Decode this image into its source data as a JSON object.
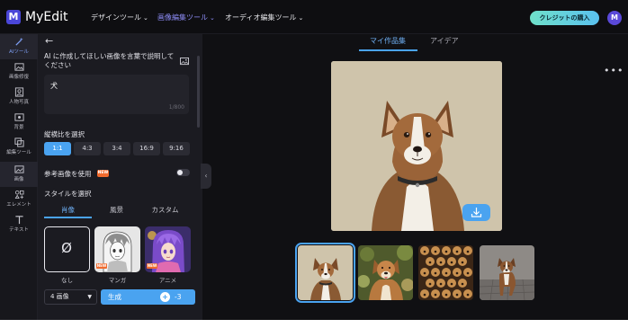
{
  "header": {
    "logo_mark": "M",
    "app_name": "MyEdit",
    "nav": [
      {
        "label": "デザインツール",
        "active": false
      },
      {
        "label": "画像編集ツール",
        "active": true
      },
      {
        "label": "オーディオ編集ツール",
        "active": false
      }
    ],
    "caret": "⌄",
    "buy_credits_label": "クレジットの購入",
    "avatar_initial": "M"
  },
  "rail": [
    {
      "label": "AIツール",
      "icon": "magic-wand-icon",
      "active": true
    },
    {
      "label": "画像修復",
      "icon": "image-repair-icon",
      "active": false
    },
    {
      "label": "人物写真",
      "icon": "portrait-icon",
      "active": false
    },
    {
      "label": "背景",
      "icon": "background-icon",
      "active": false
    },
    {
      "label": "編集ツール",
      "icon": "edit-tools-icon",
      "active": false
    },
    {
      "label": "画像",
      "icon": "image-icon",
      "active": true
    },
    {
      "label": "エレメント",
      "icon": "elements-icon",
      "active": false
    },
    {
      "label": "テキスト",
      "icon": "text-icon",
      "active": false
    }
  ],
  "panel": {
    "back_arrow": "←",
    "prompt_label": "AI に作成してほしい画像を言葉で説明してください",
    "prompt_value": "犬",
    "prompt_counter": "1/800",
    "ratio_label": "縦横比を選択",
    "ratios": [
      {
        "label": "1:1",
        "active": true
      },
      {
        "label": "4:3",
        "active": false
      },
      {
        "label": "3:4",
        "active": false
      },
      {
        "label": "16:9",
        "active": false
      },
      {
        "label": "9:16",
        "active": false
      }
    ],
    "reference_label": "参考画像を使用",
    "new_badge": "NEW",
    "reference_enabled": false,
    "style_label": "スタイルを選択",
    "style_tabs": [
      {
        "label": "肖像",
        "active": true
      },
      {
        "label": "風景",
        "active": false
      },
      {
        "label": "カスタム",
        "active": false
      }
    ],
    "styles": [
      {
        "name": "なし",
        "icon": "no-style-icon",
        "badge": ""
      },
      {
        "name": "マンガ",
        "icon": "manga-style-thumb",
        "badge": "NEW"
      },
      {
        "name": "アニメ",
        "icon": "anime-style-thumb",
        "badge": "NEW"
      }
    ],
    "none_symbol": "Ø",
    "image_count": "4 画像",
    "generate_label": "生成",
    "credit_icon": "+",
    "credit_cost": "-3"
  },
  "main": {
    "tabs": [
      {
        "label": "マイ作品集",
        "active": true
      },
      {
        "label": "アイデア",
        "active": false
      }
    ],
    "more_label": "•••",
    "collapse_arrow": "‹",
    "thumbnails": [
      {
        "name": "dog-portrait-1",
        "selected": true
      },
      {
        "name": "dog-portrait-2",
        "selected": false
      },
      {
        "name": "dog-pattern-3",
        "selected": false
      },
      {
        "name": "dog-standing-4",
        "selected": false
      }
    ]
  },
  "colors": {
    "accent": "#4aa3f0",
    "brand": "#4a46d8",
    "badge": "#f06a2d"
  }
}
